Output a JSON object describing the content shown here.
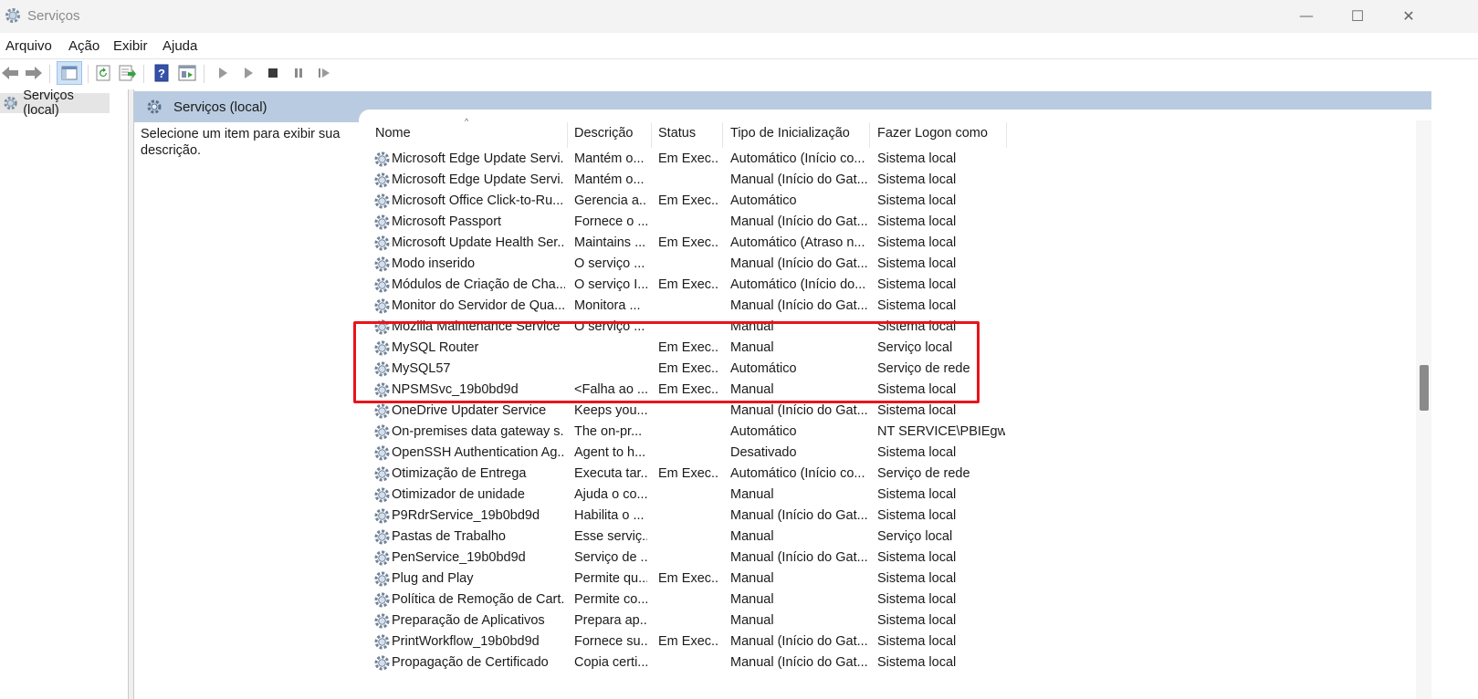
{
  "window": {
    "title": "Serviços",
    "minimize_glyph": "—",
    "maximize_glyph": "☐",
    "close_glyph": "✕"
  },
  "menu": [
    "Arquivo",
    "Ação",
    "Exibir",
    "Ajuda"
  ],
  "toolbar": {
    "items": [
      "back-icon",
      "forward-icon",
      "show-hide-tree-icon",
      "refresh-icon",
      "export-list-icon",
      "help-icon",
      "properties-icon",
      "start-service-icon",
      "start-service-alt-icon",
      "stop-service-icon",
      "pause-service-icon",
      "restart-service-icon"
    ]
  },
  "tree": {
    "label": "Serviços (local)"
  },
  "pane": {
    "title": "Serviços (local)",
    "description": "Selecione um item para exibir sua descrição."
  },
  "columns": [
    "Nome",
    "Descrição",
    "Status",
    "Tipo de Inicialização",
    "Fazer Logon como"
  ],
  "rows": [
    {
      "name": "Microsoft Edge Update Servi...",
      "desc": "Mantém o...",
      "status": "Em Exec...",
      "startup": "Automático (Início co...",
      "logon": "Sistema local"
    },
    {
      "name": "Microsoft Edge Update Servi...",
      "desc": "Mantém o...",
      "status": "",
      "startup": "Manual (Início do Gat...",
      "logon": "Sistema local"
    },
    {
      "name": "Microsoft Office Click-to-Ru...",
      "desc": "Gerencia a...",
      "status": "Em Exec...",
      "startup": "Automático",
      "logon": "Sistema local"
    },
    {
      "name": "Microsoft Passport",
      "desc": "Fornece o ...",
      "status": "",
      "startup": "Manual (Início do Gat...",
      "logon": "Sistema local"
    },
    {
      "name": "Microsoft Update Health Ser...",
      "desc": "Maintains ...",
      "status": "Em Exec...",
      "startup": "Automático (Atraso n...",
      "logon": "Sistema local"
    },
    {
      "name": "Modo inserido",
      "desc": "O serviço ...",
      "status": "",
      "startup": "Manual (Início do Gat...",
      "logon": "Sistema local"
    },
    {
      "name": "Módulos de Criação de Cha...",
      "desc": "O serviço I...",
      "status": "Em Exec...",
      "startup": "Automático (Início do...",
      "logon": "Sistema local"
    },
    {
      "name": "Monitor do Servidor de Qua...",
      "desc": "Monitora ...",
      "status": "",
      "startup": "Manual (Início do Gat...",
      "logon": "Sistema local"
    },
    {
      "name": "Mozilla Maintenance Service",
      "desc": "O serviço ...",
      "status": "",
      "startup": "Manual",
      "logon": "Sistema local"
    },
    {
      "name": "MySQL Router",
      "desc": "",
      "status": "Em Exec...",
      "startup": "Manual",
      "logon": "Serviço local"
    },
    {
      "name": "MySQL57",
      "desc": "",
      "status": "Em Exec...",
      "startup": "Automático",
      "logon": "Serviço de rede"
    },
    {
      "name": "NPSMSvc_19b0bd9d",
      "desc": "<Falha ao ...",
      "status": "Em Exec...",
      "startup": "Manual",
      "logon": "Sistema local"
    },
    {
      "name": "OneDrive Updater Service",
      "desc": "Keeps you...",
      "status": "",
      "startup": "Manual (Início do Gat...",
      "logon": "Sistema local"
    },
    {
      "name": "On-premises data gateway s...",
      "desc": "The on-pr...",
      "status": "",
      "startup": "Automático",
      "logon": "NT SERVICE\\PBIEgw..."
    },
    {
      "name": "OpenSSH Authentication Ag...",
      "desc": "Agent to h...",
      "status": "",
      "startup": "Desativado",
      "logon": "Sistema local"
    },
    {
      "name": "Otimização de Entrega",
      "desc": "Executa tar...",
      "status": "Em Exec...",
      "startup": "Automático (Início co...",
      "logon": "Serviço de rede"
    },
    {
      "name": "Otimizador de unidade",
      "desc": "Ajuda o co...",
      "status": "",
      "startup": "Manual",
      "logon": "Sistema local"
    },
    {
      "name": "P9RdrService_19b0bd9d",
      "desc": "Habilita o ...",
      "status": "",
      "startup": "Manual (Início do Gat...",
      "logon": "Sistema local"
    },
    {
      "name": "Pastas de Trabalho",
      "desc": "Esse serviç...",
      "status": "",
      "startup": "Manual",
      "logon": "Serviço local"
    },
    {
      "name": "PenService_19b0bd9d",
      "desc": "Serviço de ...",
      "status": "",
      "startup": "Manual (Início do Gat...",
      "logon": "Sistema local"
    },
    {
      "name": "Plug and Play",
      "desc": "Permite qu...",
      "status": "Em Exec...",
      "startup": "Manual",
      "logon": "Sistema local"
    },
    {
      "name": "Política de Remoção de Cart...",
      "desc": "Permite co...",
      "status": "",
      "startup": "Manual",
      "logon": "Sistema local"
    },
    {
      "name": "Preparação de Aplicativos",
      "desc": "Prepara ap...",
      "status": "",
      "startup": "Manual",
      "logon": "Sistema local"
    },
    {
      "name": "PrintWorkflow_19b0bd9d",
      "desc": "Fornece su...",
      "status": "Em Exec...",
      "startup": "Manual (Início do Gat...",
      "logon": "Sistema local"
    },
    {
      "name": "Propagação de Certificado",
      "desc": "Copia certi...",
      "status": "",
      "startup": "Manual (Início do Gat...",
      "logon": "Sistema local"
    }
  ],
  "colors": {
    "highlight_box": "#e8141c",
    "header_band": "#b9cbe0"
  }
}
